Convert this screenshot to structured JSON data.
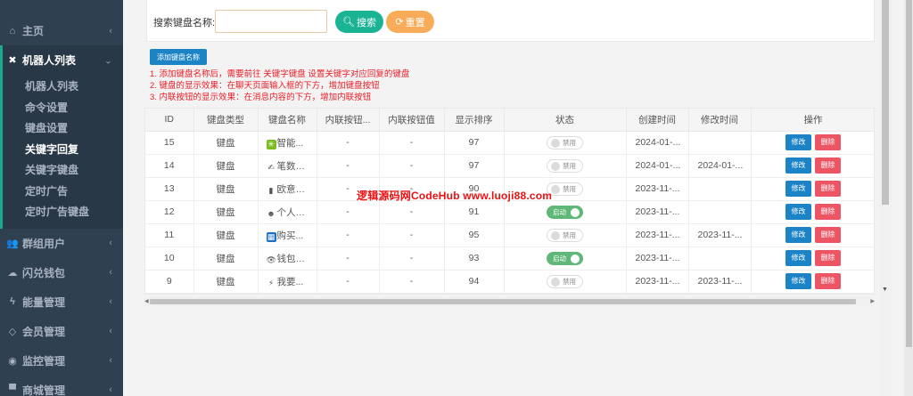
{
  "sidebar": {
    "items": [
      {
        "label": "主页",
        "icon": "home-icon",
        "glyph": "⌂"
      },
      {
        "label": "机器人列表",
        "icon": "robot-icon",
        "glyph": "✖"
      },
      {
        "label": "群组用户",
        "icon": "users-icon",
        "glyph": "👥"
      },
      {
        "label": "闪兑钱包",
        "icon": "cloud-icon",
        "glyph": "☁"
      },
      {
        "label": "能量管理",
        "icon": "bolt-icon",
        "glyph": "⚡"
      },
      {
        "label": "会员管理",
        "icon": "diamond-icon",
        "glyph": "◇"
      },
      {
        "label": "监控管理",
        "icon": "eye-icon",
        "glyph": "◉"
      },
      {
        "label": "商城管理",
        "icon": "cart-icon",
        "glyph": "▀"
      }
    ],
    "sub_items": [
      "机器人列表",
      "命令设置",
      "键盘设置",
      "关键字回复",
      "关键字键盘",
      "定时广告",
      "定时广告键盘"
    ]
  },
  "search": {
    "label": "搜索键盘名称:",
    "input_value": "",
    "search_btn": "搜索",
    "reset_btn": "重置"
  },
  "add_button": "添加键盘名称",
  "notes": [
    "1. 添加键盘名称后，需要前往 关键字键盘 设置关键字对应回复的键盘",
    "2. 键盘的显示效果：在聊天页面输入框的下方，增加键盘按钮",
    "3. 内联按钮的显示效果：在消息内容的下方，增加内联按钮"
  ],
  "table": {
    "headers": [
      "ID",
      "键盘类型",
      "键盘名称",
      "内联按钮...",
      "内联按钮值",
      "显示排序",
      "状态",
      "创建时间",
      "修改时间",
      "操作"
    ],
    "edit_label": "修改",
    "delete_label": "删除",
    "rows": [
      {
        "id": "15",
        "type": "键盘",
        "emoji": "✳",
        "emoji_bg": "#7cbb1c",
        "name": "智能...",
        "inline_btn": "-",
        "inline_val": "-",
        "order": "97",
        "status_on": false,
        "status": "禁用",
        "created": "2024-01-...",
        "modified": ""
      },
      {
        "id": "14",
        "type": "键盘",
        "emoji": "✍",
        "emoji_bg": "transparent",
        "name": "笔数套餐",
        "inline_btn": "-",
        "inline_val": "-",
        "order": "97",
        "status_on": false,
        "status": "禁用",
        "created": "2024-01-...",
        "modified": "2024-01-..."
      },
      {
        "id": "13",
        "type": "键盘",
        "emoji": "▮",
        "emoji_bg": "transparent",
        "name": "欧意汇率",
        "inline_btn": "-",
        "inline_val": "-",
        "order": "90",
        "status_on": false,
        "status": "禁用",
        "created": "2023-11-...",
        "modified": ""
      },
      {
        "id": "12",
        "type": "键盘",
        "emoji": "☻",
        "emoji_bg": "transparent",
        "name": "个人中心",
        "inline_btn": "-",
        "inline_val": "-",
        "order": "91",
        "status_on": true,
        "status": "启动",
        "created": "2023-11-...",
        "modified": ""
      },
      {
        "id": "11",
        "type": "键盘",
        "emoji": "▦",
        "emoji_bg": "#1c6fc6",
        "name": "购买...",
        "inline_btn": "-",
        "inline_val": "-",
        "order": "95",
        "status_on": false,
        "status": "禁用",
        "created": "2023-11-...",
        "modified": "2023-11-..."
      },
      {
        "id": "10",
        "type": "键盘",
        "emoji": "👁",
        "emoji_bg": "transparent",
        "name": "钱包监控",
        "inline_btn": "-",
        "inline_val": "-",
        "order": "93",
        "status_on": true,
        "status": "启动",
        "created": "2023-11-...",
        "modified": ""
      },
      {
        "id": "9",
        "type": "键盘",
        "emoji": "⚡",
        "emoji_bg": "transparent",
        "name": "我要...",
        "inline_btn": "-",
        "inline_val": "-",
        "order": "94",
        "status_on": false,
        "status": "禁用",
        "created": "2023-11-...",
        "modified": "2023-11-..."
      }
    ]
  },
  "watermark": "逻辑源码网CodeHub  www.luoji88.com",
  "colors": {
    "sidebar_bg": "#2f4050",
    "primary": "#1ab394",
    "warning": "#f8ac59",
    "info": "#1c84c6",
    "danger": "#ed5565",
    "toggle_on": "#5fb878"
  }
}
